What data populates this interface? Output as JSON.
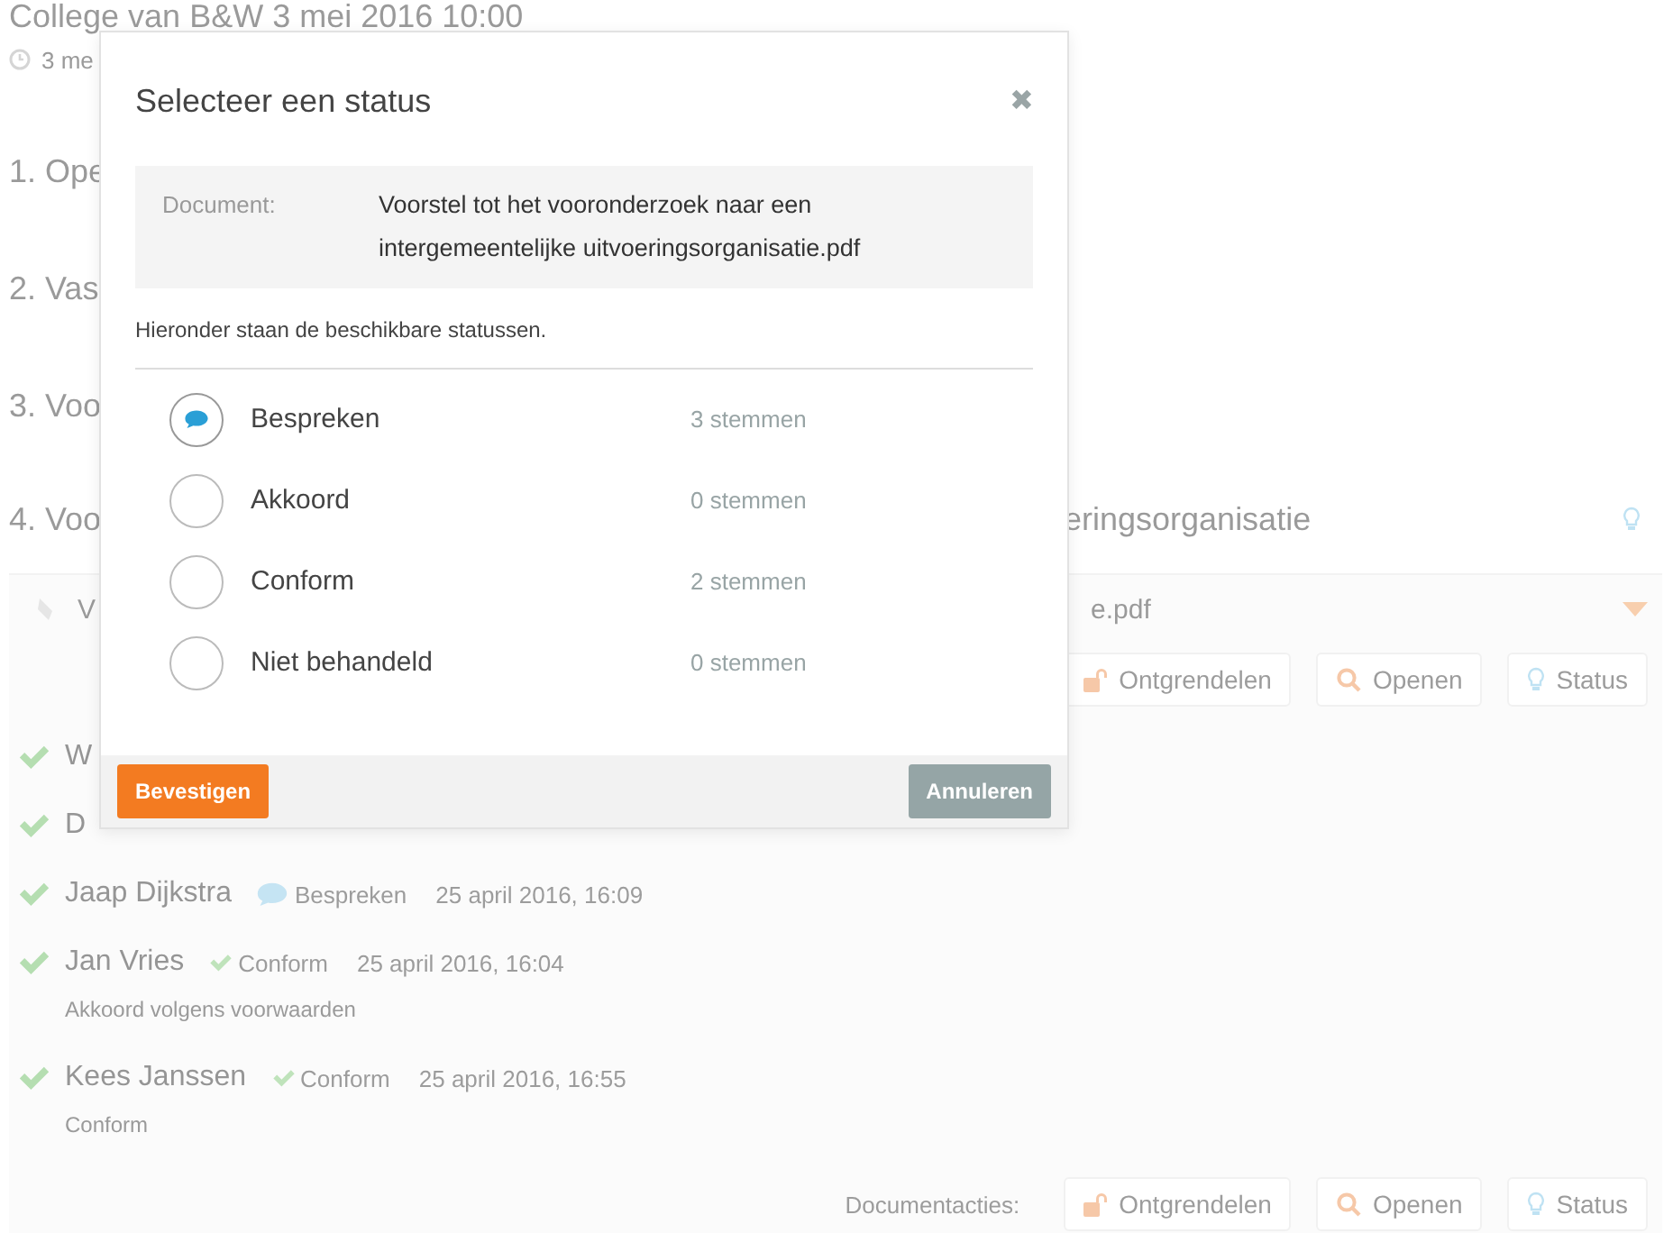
{
  "page": {
    "title": "College van B&W 3 mei 2016 10:00",
    "date": "3 me",
    "agenda": [
      {
        "label": "1. Ope"
      },
      {
        "label": "2. Vas"
      },
      {
        "label": "3. Voo"
      }
    ],
    "agenda_item": {
      "label_start": "4. Voo",
      "label_end": "eringsorganisatie"
    },
    "document": {
      "name_start": "V",
      "name_end": "e.pdf",
      "expanded": true
    },
    "actions_top": [
      {
        "kind": "unlock",
        "label": "Ontgrendelen"
      },
      {
        "kind": "open",
        "label": "Openen"
      },
      {
        "kind": "status",
        "label": "Status"
      }
    ],
    "votes": [
      {
        "name": "W"
      },
      {
        "name": "D"
      },
      {
        "name": "Jaap Dijkstra",
        "status": {
          "kind": "discuss",
          "label": "Bespreken"
        },
        "time": "25 april 2016, 16:09"
      },
      {
        "name": "Jan Vries",
        "status": {
          "kind": "agree",
          "label": "Conform"
        },
        "time": "25 april 2016, 16:04",
        "comment": "Akkoord volgens voorwaarden"
      },
      {
        "name": "Kees Janssen",
        "status": {
          "kind": "agree",
          "label": "Conform"
        },
        "time": "25 april 2016, 16:55",
        "comment": "Conform"
      }
    ],
    "footer": {
      "label": "Documentacties:",
      "actions": [
        {
          "kind": "unlock",
          "label": "Ontgrendelen"
        },
        {
          "kind": "open",
          "label": "Openen"
        },
        {
          "kind": "status",
          "label": "Status"
        }
      ]
    }
  },
  "modal": {
    "title": "Selecteer een status",
    "close": "✖",
    "document_label": "Document:",
    "document_name": "Voorstel tot het vooronderzoek naar een intergemeentelijke uitvoeringsorganisatie.pdf",
    "intro": "Hieronder staan de beschikbare statussen.",
    "options": [
      {
        "label": "Bespreken",
        "votes": "3 stemmen",
        "selected": true
      },
      {
        "label": "Akkoord",
        "votes": "0 stemmen",
        "selected": false
      },
      {
        "label": "Conform",
        "votes": "2 stemmen",
        "selected": false
      },
      {
        "label": "Niet behandeld",
        "votes": "0 stemmen",
        "selected": false
      }
    ],
    "confirm": "Bevestigen",
    "cancel": "Annuleren"
  }
}
